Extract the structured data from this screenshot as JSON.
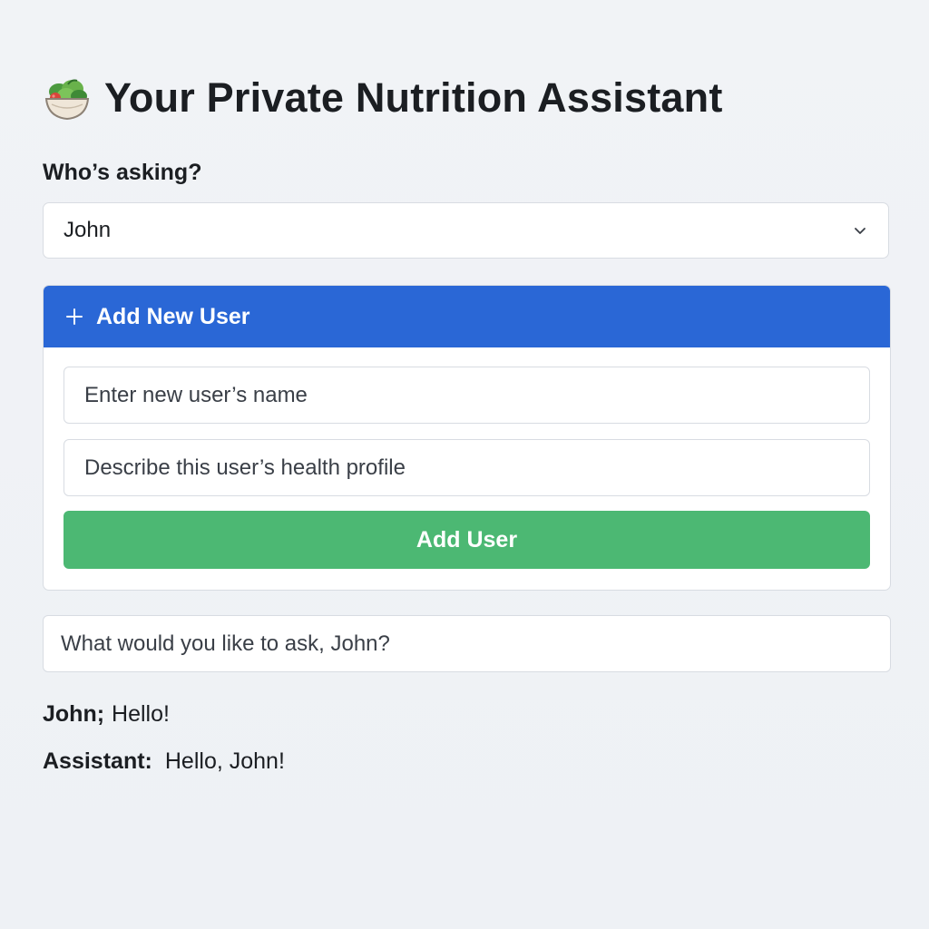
{
  "header": {
    "title": "Your Private Nutrition Assistant",
    "icon": "salad-icon"
  },
  "user_select": {
    "label": "Who’s asking?",
    "selected": "John"
  },
  "add_user_panel": {
    "header_label": "Add New User",
    "name_placeholder": "Enter new user’s name",
    "profile_placeholder": "Describe this user’s health profile",
    "button_label": "Add User"
  },
  "question_input": {
    "placeholder": "What would you like to ask, John?"
  },
  "chat": [
    {
      "speaker": "John;",
      "message": "Hello!"
    },
    {
      "speaker": "Assistant:",
      "message": "Hello, John!"
    }
  ],
  "colors": {
    "primary_blue": "#2a67d6",
    "success_green": "#4cb873",
    "background": "#f1f3f6"
  }
}
